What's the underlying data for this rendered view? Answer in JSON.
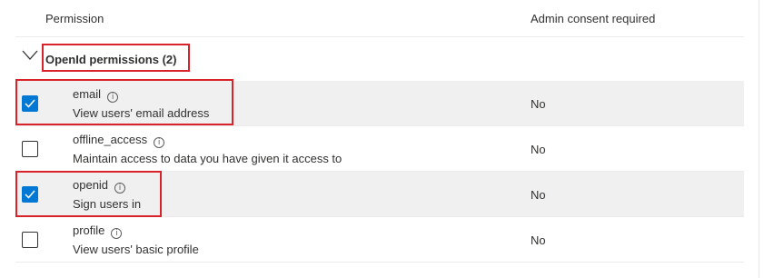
{
  "table": {
    "header_permission": "Permission",
    "header_admin_consent": "Admin consent required"
  },
  "group": {
    "label": "OpenId permissions (2)",
    "expanded": true
  },
  "rows": [
    {
      "name": "email",
      "description": "View users' email address",
      "admin_consent": "No",
      "checked": true
    },
    {
      "name": "offline_access",
      "description": "Maintain access to data you have given it access to",
      "admin_consent": "No",
      "checked": false
    },
    {
      "name": "openid",
      "description": "Sign users in",
      "admin_consent": "No",
      "checked": true
    },
    {
      "name": "profile",
      "description": "View users' basic profile",
      "admin_consent": "No",
      "checked": false
    }
  ],
  "icons": {
    "info": "info-icon",
    "chevron": "chevron-down-icon",
    "check": "checkmark-icon"
  },
  "colors": {
    "accent": "#0078d4",
    "highlight": "#d8232a",
    "selected_row": "#f0f0f0"
  }
}
